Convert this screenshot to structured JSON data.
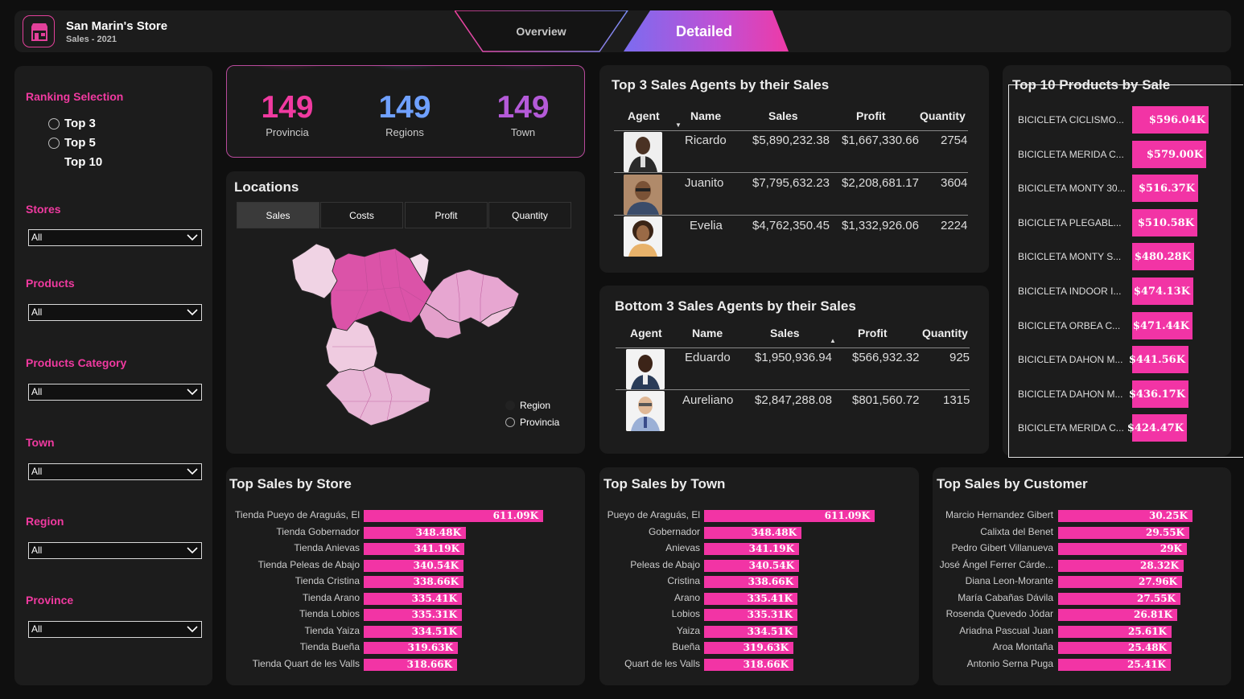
{
  "header": {
    "title": "San Marin's Store",
    "subtitle": "Sales - 2021",
    "tabs": {
      "overview": "Overview",
      "detailed": "Detailed"
    }
  },
  "slicers": {
    "ranking": {
      "label": "Ranking Selection",
      "options": [
        "Top 3",
        "Top 5",
        "Top 10"
      ]
    },
    "stores": {
      "label": "Stores",
      "value": "All"
    },
    "products": {
      "label": "Products",
      "value": "All"
    },
    "products_category": {
      "label": "Products Category",
      "value": "All"
    },
    "town": {
      "label": "Town",
      "value": "All"
    },
    "region": {
      "label": "Region",
      "value": "All"
    },
    "province": {
      "label": "Province",
      "value": "All"
    }
  },
  "kpis": [
    {
      "value": "149",
      "label": "Provincia",
      "color": "#f03aa0"
    },
    {
      "value": "149",
      "label": "Regions",
      "color": "#6fa0ff"
    },
    {
      "value": "149",
      "label": "Town",
      "color": "#b45ad8"
    }
  ],
  "locations": {
    "title": "Locations",
    "tabs": [
      "Sales",
      "Costs",
      "Profit",
      "Quantity"
    ],
    "legend": {
      "region": "Region",
      "provincia": "Provincia"
    }
  },
  "top_agents": {
    "title": "Top 3 Sales Agents by their Sales",
    "columns": [
      "Agent",
      "Name",
      "Sales",
      "Profit",
      "Quantity"
    ],
    "rows": [
      {
        "name": "Ricardo",
        "sales": "$5,890,232.38",
        "profit": "$1,667,330.66",
        "quantity": "2754"
      },
      {
        "name": "Juanito",
        "sales": "$7,795,632.23",
        "profit": "$2,208,681.17",
        "quantity": "3604"
      },
      {
        "name": "Evelia",
        "sales": "$4,762,350.45",
        "profit": "$1,332,926.06",
        "quantity": "2224"
      }
    ]
  },
  "bottom_agents": {
    "title": "Bottom 3 Sales Agents by their Sales",
    "columns": [
      "Agent",
      "Name",
      "Sales",
      "Profit",
      "Quantity"
    ],
    "rows": [
      {
        "name": "Eduardo",
        "sales": "$1,950,936.94",
        "profit": "$566,932.32",
        "quantity": "925"
      },
      {
        "name": "Aureliano",
        "sales": "$2,847,288.08",
        "profit": "$801,560.72",
        "quantity": "1315"
      }
    ]
  },
  "chart_data": [
    {
      "type": "bar",
      "title": "Top 10 Products by Sale",
      "categories": [
        "BICICLETA CICLISMO...",
        "BICICLETA MERIDA C...",
        "BICICLETA MONTY 30...",
        "BICICLETA PLEGABL...",
        "BICICLETA MONTY S...",
        "BICICLETA INDOOR I...",
        "BICICLETA ORBEA C...",
        "BICICLETA DAHON M...",
        "BICICLETA DAHON M...",
        "BICICLETA MERIDA C..."
      ],
      "values": [
        596.04,
        579.0,
        516.37,
        510.58,
        480.28,
        474.13,
        471.44,
        441.56,
        436.17,
        424.47
      ],
      "labels": [
        "$596.04K",
        "$579.00K",
        "$516.37K",
        "$510.58K",
        "$480.28K",
        "$474.13K",
        "$471.44K",
        "$441.56K",
        "$436.17K",
        "$424.47K"
      ]
    },
    {
      "type": "bar",
      "title": "Top Sales by Store",
      "categories": [
        "Tienda Pueyo de Araguás, El",
        "Tienda Gobernador",
        "Tienda Anievas",
        "Tienda Peleas de Abajo",
        "Tienda Cristina",
        "Tienda Arano",
        "Tienda Lobios",
        "Tienda Yaiza",
        "Tienda Bueña",
        "Tienda Quart de les Valls"
      ],
      "values": [
        611.09,
        348.48,
        341.19,
        340.54,
        338.66,
        335.41,
        335.31,
        334.51,
        319.63,
        318.66
      ],
      "labels": [
        "611.09K",
        "348.48K",
        "341.19K",
        "340.54K",
        "338.66K",
        "335.41K",
        "335.31K",
        "334.51K",
        "319.63K",
        "318.66K"
      ]
    },
    {
      "type": "bar",
      "title": "Top Sales by Town",
      "categories": [
        "Pueyo de Araguás, El",
        "Gobernador",
        "Anievas",
        "Peleas de Abajo",
        "Cristina",
        "Arano",
        "Lobios",
        "Yaiza",
        "Bueña",
        "Quart de les Valls"
      ],
      "values": [
        611.09,
        348.48,
        341.19,
        340.54,
        338.66,
        335.41,
        335.31,
        334.51,
        319.63,
        318.66
      ],
      "labels": [
        "611.09K",
        "348.48K",
        "341.19K",
        "340.54K",
        "338.66K",
        "335.41K",
        "335.31K",
        "334.51K",
        "319.63K",
        "318.66K"
      ]
    },
    {
      "type": "bar",
      "title": "Top Sales by Customer",
      "categories": [
        "Marcio Hernandez Gibert",
        "Calixta del Benet",
        "Pedro Gibert Villanueva",
        "José Ángel Ferrer Cárde...",
        "Diana Leon-Morante",
        "María Cabañas Dávila",
        "Rosenda Quevedo Jódar",
        "Ariadna Pascual Juan",
        "Aroa Montaña",
        "Antonio Serna Puga"
      ],
      "values": [
        30.25,
        29.55,
        29.0,
        28.32,
        27.96,
        27.55,
        26.81,
        25.61,
        25.48,
        25.41
      ],
      "labels": [
        "30.25K",
        "29.55K",
        "29K",
        "28.32K",
        "27.96K",
        "27.55K",
        "26.81K",
        "25.61K",
        "25.48K",
        "25.41K"
      ]
    }
  ]
}
